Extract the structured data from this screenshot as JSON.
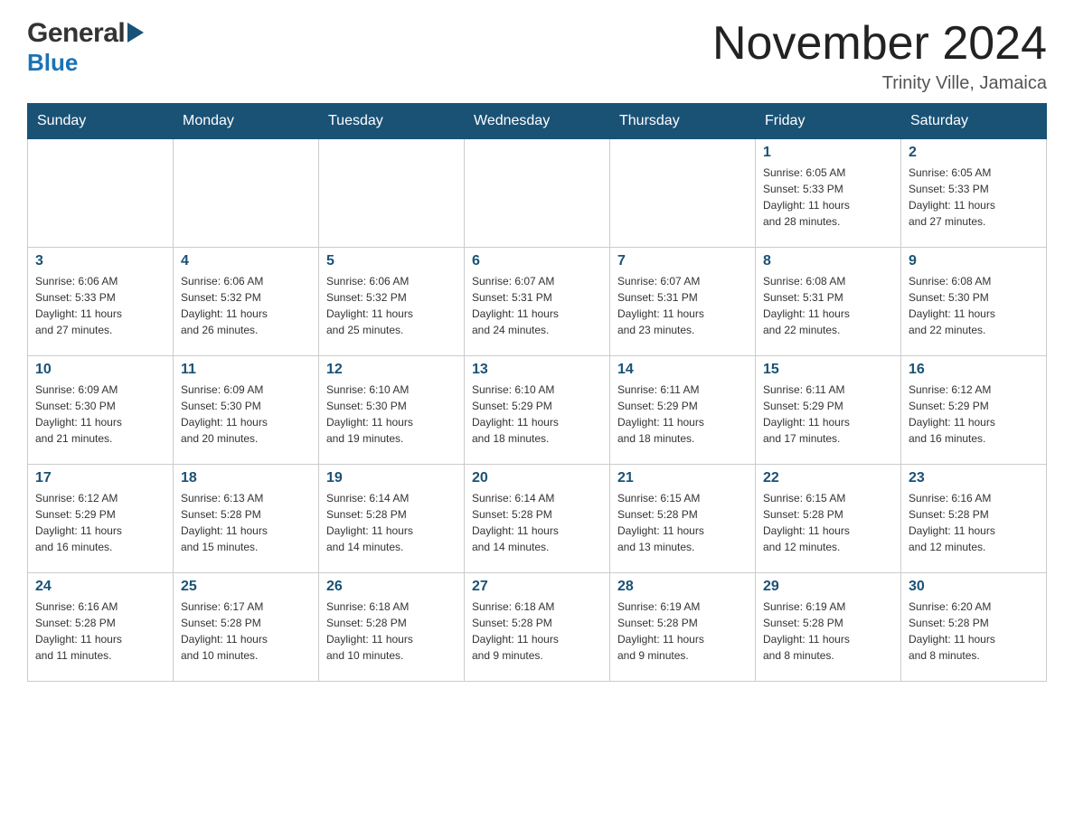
{
  "logo": {
    "general": "General",
    "blue": "Blue"
  },
  "title": "November 2024",
  "location": "Trinity Ville, Jamaica",
  "days_of_week": [
    "Sunday",
    "Monday",
    "Tuesday",
    "Wednesday",
    "Thursday",
    "Friday",
    "Saturday"
  ],
  "weeks": [
    [
      {
        "day": "",
        "info": ""
      },
      {
        "day": "",
        "info": ""
      },
      {
        "day": "",
        "info": ""
      },
      {
        "day": "",
        "info": ""
      },
      {
        "day": "",
        "info": ""
      },
      {
        "day": "1",
        "info": "Sunrise: 6:05 AM\nSunset: 5:33 PM\nDaylight: 11 hours\nand 28 minutes."
      },
      {
        "day": "2",
        "info": "Sunrise: 6:05 AM\nSunset: 5:33 PM\nDaylight: 11 hours\nand 27 minutes."
      }
    ],
    [
      {
        "day": "3",
        "info": "Sunrise: 6:06 AM\nSunset: 5:33 PM\nDaylight: 11 hours\nand 27 minutes."
      },
      {
        "day": "4",
        "info": "Sunrise: 6:06 AM\nSunset: 5:32 PM\nDaylight: 11 hours\nand 26 minutes."
      },
      {
        "day": "5",
        "info": "Sunrise: 6:06 AM\nSunset: 5:32 PM\nDaylight: 11 hours\nand 25 minutes."
      },
      {
        "day": "6",
        "info": "Sunrise: 6:07 AM\nSunset: 5:31 PM\nDaylight: 11 hours\nand 24 minutes."
      },
      {
        "day": "7",
        "info": "Sunrise: 6:07 AM\nSunset: 5:31 PM\nDaylight: 11 hours\nand 23 minutes."
      },
      {
        "day": "8",
        "info": "Sunrise: 6:08 AM\nSunset: 5:31 PM\nDaylight: 11 hours\nand 22 minutes."
      },
      {
        "day": "9",
        "info": "Sunrise: 6:08 AM\nSunset: 5:30 PM\nDaylight: 11 hours\nand 22 minutes."
      }
    ],
    [
      {
        "day": "10",
        "info": "Sunrise: 6:09 AM\nSunset: 5:30 PM\nDaylight: 11 hours\nand 21 minutes."
      },
      {
        "day": "11",
        "info": "Sunrise: 6:09 AM\nSunset: 5:30 PM\nDaylight: 11 hours\nand 20 minutes."
      },
      {
        "day": "12",
        "info": "Sunrise: 6:10 AM\nSunset: 5:30 PM\nDaylight: 11 hours\nand 19 minutes."
      },
      {
        "day": "13",
        "info": "Sunrise: 6:10 AM\nSunset: 5:29 PM\nDaylight: 11 hours\nand 18 minutes."
      },
      {
        "day": "14",
        "info": "Sunrise: 6:11 AM\nSunset: 5:29 PM\nDaylight: 11 hours\nand 18 minutes."
      },
      {
        "day": "15",
        "info": "Sunrise: 6:11 AM\nSunset: 5:29 PM\nDaylight: 11 hours\nand 17 minutes."
      },
      {
        "day": "16",
        "info": "Sunrise: 6:12 AM\nSunset: 5:29 PM\nDaylight: 11 hours\nand 16 minutes."
      }
    ],
    [
      {
        "day": "17",
        "info": "Sunrise: 6:12 AM\nSunset: 5:29 PM\nDaylight: 11 hours\nand 16 minutes."
      },
      {
        "day": "18",
        "info": "Sunrise: 6:13 AM\nSunset: 5:28 PM\nDaylight: 11 hours\nand 15 minutes."
      },
      {
        "day": "19",
        "info": "Sunrise: 6:14 AM\nSunset: 5:28 PM\nDaylight: 11 hours\nand 14 minutes."
      },
      {
        "day": "20",
        "info": "Sunrise: 6:14 AM\nSunset: 5:28 PM\nDaylight: 11 hours\nand 14 minutes."
      },
      {
        "day": "21",
        "info": "Sunrise: 6:15 AM\nSunset: 5:28 PM\nDaylight: 11 hours\nand 13 minutes."
      },
      {
        "day": "22",
        "info": "Sunrise: 6:15 AM\nSunset: 5:28 PM\nDaylight: 11 hours\nand 12 minutes."
      },
      {
        "day": "23",
        "info": "Sunrise: 6:16 AM\nSunset: 5:28 PM\nDaylight: 11 hours\nand 12 minutes."
      }
    ],
    [
      {
        "day": "24",
        "info": "Sunrise: 6:16 AM\nSunset: 5:28 PM\nDaylight: 11 hours\nand 11 minutes."
      },
      {
        "day": "25",
        "info": "Sunrise: 6:17 AM\nSunset: 5:28 PM\nDaylight: 11 hours\nand 10 minutes."
      },
      {
        "day": "26",
        "info": "Sunrise: 6:18 AM\nSunset: 5:28 PM\nDaylight: 11 hours\nand 10 minutes."
      },
      {
        "day": "27",
        "info": "Sunrise: 6:18 AM\nSunset: 5:28 PM\nDaylight: 11 hours\nand 9 minutes."
      },
      {
        "day": "28",
        "info": "Sunrise: 6:19 AM\nSunset: 5:28 PM\nDaylight: 11 hours\nand 9 minutes."
      },
      {
        "day": "29",
        "info": "Sunrise: 6:19 AM\nSunset: 5:28 PM\nDaylight: 11 hours\nand 8 minutes."
      },
      {
        "day": "30",
        "info": "Sunrise: 6:20 AM\nSunset: 5:28 PM\nDaylight: 11 hours\nand 8 minutes."
      }
    ]
  ]
}
